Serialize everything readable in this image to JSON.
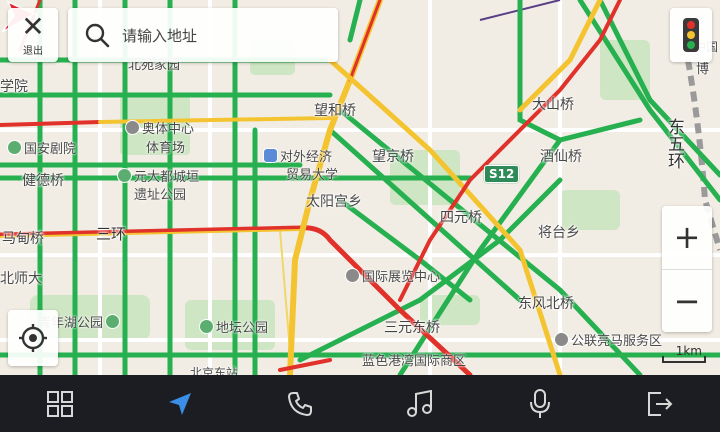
{
  "top": {
    "exit_label": "退出",
    "search_placeholder": "请输入地址"
  },
  "map": {
    "roads": {
      "second_ring_label": "三环",
      "east_fifth_ring": "东五环",
      "expressway_shield": "S12"
    },
    "bridges": [
      "望和桥",
      "望京桥",
      "大山桥",
      "四元桥",
      "健德桥",
      "马甸桥",
      "三元东桥",
      "东风北桥",
      "太阳宫乡"
    ],
    "places": [
      "北苑家园",
      "奥体中心",
      "体育场",
      "国安剧院",
      "对外经济",
      "贸易大学",
      "元大都城垣",
      "遗址公园",
      "国际展览中心",
      "青年湖公园",
      "地坛公园",
      "蓝色港湾国际商区",
      "公联亮马服务区",
      "酒仙桥",
      "将台乡",
      "北师大",
      "学院",
      "中国",
      "博",
      "北京东站"
    ],
    "scale_label": "1km"
  },
  "bottombar": {
    "items": [
      "apps-grid-icon",
      "navigation-icon",
      "phone-icon",
      "music-icon",
      "microphone-icon",
      "exit-icon"
    ],
    "active_color": "#3a8ee6",
    "icon_color": "#d8d8d8"
  },
  "colors": {
    "traffic_green": "#26b050",
    "traffic_yellow": "#f4c430",
    "traffic_red": "#e0312a",
    "nav_arrow": "#e8262a"
  }
}
